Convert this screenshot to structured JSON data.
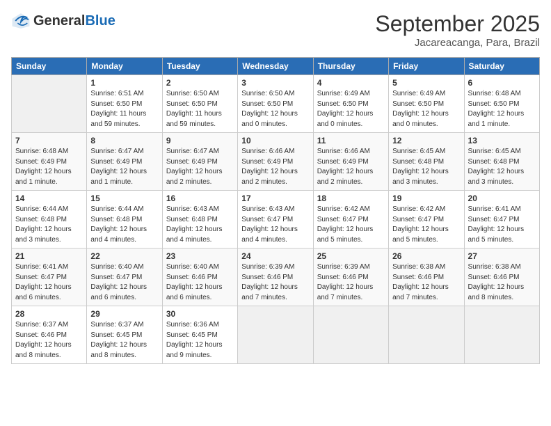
{
  "header": {
    "logo_general": "General",
    "logo_blue": "Blue",
    "month": "September 2025",
    "location": "Jacareacanga, Para, Brazil"
  },
  "weekdays": [
    "Sunday",
    "Monday",
    "Tuesday",
    "Wednesday",
    "Thursday",
    "Friday",
    "Saturday"
  ],
  "weeks": [
    [
      {
        "day": "",
        "info": ""
      },
      {
        "day": "1",
        "info": "Sunrise: 6:51 AM\nSunset: 6:50 PM\nDaylight: 11 hours\nand 59 minutes."
      },
      {
        "day": "2",
        "info": "Sunrise: 6:50 AM\nSunset: 6:50 PM\nDaylight: 11 hours\nand 59 minutes."
      },
      {
        "day": "3",
        "info": "Sunrise: 6:50 AM\nSunset: 6:50 PM\nDaylight: 12 hours\nand 0 minutes."
      },
      {
        "day": "4",
        "info": "Sunrise: 6:49 AM\nSunset: 6:50 PM\nDaylight: 12 hours\nand 0 minutes."
      },
      {
        "day": "5",
        "info": "Sunrise: 6:49 AM\nSunset: 6:50 PM\nDaylight: 12 hours\nand 0 minutes."
      },
      {
        "day": "6",
        "info": "Sunrise: 6:48 AM\nSunset: 6:50 PM\nDaylight: 12 hours\nand 1 minute."
      }
    ],
    [
      {
        "day": "7",
        "info": "Sunrise: 6:48 AM\nSunset: 6:49 PM\nDaylight: 12 hours\nand 1 minute."
      },
      {
        "day": "8",
        "info": "Sunrise: 6:47 AM\nSunset: 6:49 PM\nDaylight: 12 hours\nand 1 minute."
      },
      {
        "day": "9",
        "info": "Sunrise: 6:47 AM\nSunset: 6:49 PM\nDaylight: 12 hours\nand 2 minutes."
      },
      {
        "day": "10",
        "info": "Sunrise: 6:46 AM\nSunset: 6:49 PM\nDaylight: 12 hours\nand 2 minutes."
      },
      {
        "day": "11",
        "info": "Sunrise: 6:46 AM\nSunset: 6:49 PM\nDaylight: 12 hours\nand 2 minutes."
      },
      {
        "day": "12",
        "info": "Sunrise: 6:45 AM\nSunset: 6:48 PM\nDaylight: 12 hours\nand 3 minutes."
      },
      {
        "day": "13",
        "info": "Sunrise: 6:45 AM\nSunset: 6:48 PM\nDaylight: 12 hours\nand 3 minutes."
      }
    ],
    [
      {
        "day": "14",
        "info": "Sunrise: 6:44 AM\nSunset: 6:48 PM\nDaylight: 12 hours\nand 3 minutes."
      },
      {
        "day": "15",
        "info": "Sunrise: 6:44 AM\nSunset: 6:48 PM\nDaylight: 12 hours\nand 4 minutes."
      },
      {
        "day": "16",
        "info": "Sunrise: 6:43 AM\nSunset: 6:48 PM\nDaylight: 12 hours\nand 4 minutes."
      },
      {
        "day": "17",
        "info": "Sunrise: 6:43 AM\nSunset: 6:47 PM\nDaylight: 12 hours\nand 4 minutes."
      },
      {
        "day": "18",
        "info": "Sunrise: 6:42 AM\nSunset: 6:47 PM\nDaylight: 12 hours\nand 5 minutes."
      },
      {
        "day": "19",
        "info": "Sunrise: 6:42 AM\nSunset: 6:47 PM\nDaylight: 12 hours\nand 5 minutes."
      },
      {
        "day": "20",
        "info": "Sunrise: 6:41 AM\nSunset: 6:47 PM\nDaylight: 12 hours\nand 5 minutes."
      }
    ],
    [
      {
        "day": "21",
        "info": "Sunrise: 6:41 AM\nSunset: 6:47 PM\nDaylight: 12 hours\nand 6 minutes."
      },
      {
        "day": "22",
        "info": "Sunrise: 6:40 AM\nSunset: 6:47 PM\nDaylight: 12 hours\nand 6 minutes."
      },
      {
        "day": "23",
        "info": "Sunrise: 6:40 AM\nSunset: 6:46 PM\nDaylight: 12 hours\nand 6 minutes."
      },
      {
        "day": "24",
        "info": "Sunrise: 6:39 AM\nSunset: 6:46 PM\nDaylight: 12 hours\nand 7 minutes."
      },
      {
        "day": "25",
        "info": "Sunrise: 6:39 AM\nSunset: 6:46 PM\nDaylight: 12 hours\nand 7 minutes."
      },
      {
        "day": "26",
        "info": "Sunrise: 6:38 AM\nSunset: 6:46 PM\nDaylight: 12 hours\nand 7 minutes."
      },
      {
        "day": "27",
        "info": "Sunrise: 6:38 AM\nSunset: 6:46 PM\nDaylight: 12 hours\nand 8 minutes."
      }
    ],
    [
      {
        "day": "28",
        "info": "Sunrise: 6:37 AM\nSunset: 6:46 PM\nDaylight: 12 hours\nand 8 minutes."
      },
      {
        "day": "29",
        "info": "Sunrise: 6:37 AM\nSunset: 6:45 PM\nDaylight: 12 hours\nand 8 minutes."
      },
      {
        "day": "30",
        "info": "Sunrise: 6:36 AM\nSunset: 6:45 PM\nDaylight: 12 hours\nand 9 minutes."
      },
      {
        "day": "",
        "info": ""
      },
      {
        "day": "",
        "info": ""
      },
      {
        "day": "",
        "info": ""
      },
      {
        "day": "",
        "info": ""
      }
    ]
  ]
}
